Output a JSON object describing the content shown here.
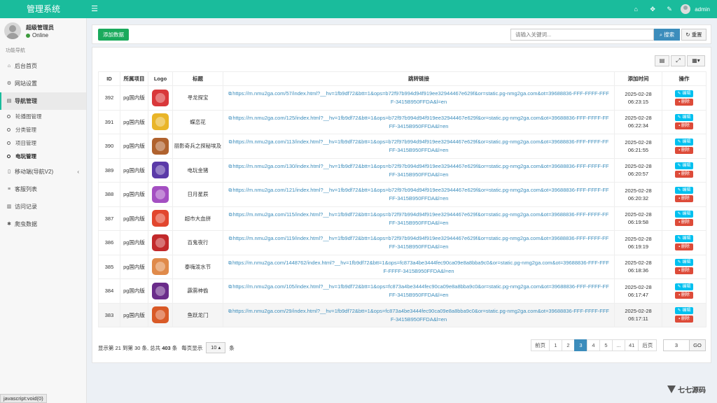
{
  "app": {
    "title": "管理系统"
  },
  "header": {
    "username": "admin"
  },
  "sidebar": {
    "user_name": "超级管理员",
    "status": "Online",
    "nav_header": "功能导航",
    "items": [
      {
        "label": "后台首页",
        "icon": "home-icon"
      },
      {
        "label": "网站设置",
        "icon": "cogs-icon"
      },
      {
        "label": "导航管理",
        "icon": "list-icon",
        "active": true
      },
      {
        "label": "移动端(导航V2)",
        "icon": "tablet-icon"
      },
      {
        "label": "客服列表",
        "icon": "bars-icon"
      },
      {
        "label": "访问记录",
        "icon": "chart-icon"
      },
      {
        "label": "爬虫数据",
        "icon": "bug-icon"
      }
    ],
    "subitems": [
      {
        "label": "轮播图管理"
      },
      {
        "label": "分类管理"
      },
      {
        "label": "项目管理"
      },
      {
        "label": "电玩管理",
        "active": true
      }
    ]
  },
  "toolbar": {
    "add_label": "添加数据",
    "search_placeholder": "请输入关键词...",
    "search_label": "搜索",
    "reset_label": "重置"
  },
  "table": {
    "columns": [
      "ID",
      "所属项目",
      "Logo",
      "标题",
      "跳转链接",
      "添加时间",
      "操作"
    ],
    "edit_label": "编辑",
    "delete_label": "删除",
    "rows": [
      {
        "id": "392",
        "project": "pg国内版",
        "logo_color": "#d9383a",
        "title": "寻龙探宝",
        "link": "https://m.nmu2ga.com/57/index.html?__hv=1fb9df72&btt=1&ops=b72f97b994d94f919ee32944467e629f&or=static.pg-nmg2ga.com&ot=39688836-FFF-FFFF-FFFF-3415B950FFDA&l=en",
        "date": "2025-02-28",
        "time": "06:23:15"
      },
      {
        "id": "391",
        "project": "pg国内版",
        "logo_color": "#e9b528",
        "title": "蝶恋花",
        "link": "https://m.nmu2ga.com/125/index.html?__hv=1fb9df72&btt=1&ops=b72f97b994d94f919ee32944467e629f&or=static.pg-nmg2ga.com&ot=39688836-FFF-FFFF-FFFF-3415B950FFDA&l=en",
        "date": "2025-02-28",
        "time": "06:22:34"
      },
      {
        "id": "390",
        "project": "pg国内版",
        "logo_color": "#b0622e",
        "title": "丽影奇兵之探秘埃及",
        "link": "https://m.nmu2ga.com/113/index.html?__hv=1fb9df72&btt=1&ops=b72f97b994d94f919ee32944467e629f&or=static.pg-nmg2ga.com&ot=39688836-FFF-FFFF-FFFF-3415B950FFDA&l=en",
        "date": "2025-02-28",
        "time": "06:21:55"
      },
      {
        "id": "389",
        "project": "pg国内版",
        "logo_color": "#5b3aa8",
        "title": "电玩金猪",
        "link": "https://m.nmu2ga.com/130/index.html?__hv=1fb9df72&btt=1&ops=b72f97b994d94f919ee32944467e629f&or=static.pg-nmg2ga.com&ot=39688836-FFF-FFFF-FFFF-3415B950FFDA&l=en",
        "date": "2025-02-28",
        "time": "06:20:57"
      },
      {
        "id": "388",
        "project": "pg国内版",
        "logo_color": "#a44fc2",
        "title": "日月星辰",
        "link": "https://m.nmu2ga.com/121/index.html?__hv=1fb9df72&btt=1&ops=b72f97b994d94f919ee32944467e629f&or=static.pg-nmg2ga.com&ot=39688836-FFF-FFFF-FFFF-3415B950FFDA&l=en",
        "date": "2025-02-28",
        "time": "06:20:32"
      },
      {
        "id": "387",
        "project": "pg国内版",
        "logo_color": "#e2462e",
        "title": "超市大血拼",
        "link": "https://m.nmu2ga.com/115/index.html?__hv=1fb9df72&btt=1&ops=b72f97b994d94f919ee32944467e629f&or=static.pg-nmg2ga.com&ot=39688836-FFF-FFFF-FFFF-3415B950FFDA&l=en",
        "date": "2025-02-28",
        "time": "06:19:58"
      },
      {
        "id": "386",
        "project": "pg国内版",
        "logo_color": "#c2292b",
        "title": "百鬼夜行",
        "link": "https://m.nmu2ga.com/119/index.html?__hv=1fb9df72&btt=1&ops=b72f97b994d94f919ee32944467e629f&or=static.pg-nmg2ga.com&ot=39688836-FFF-FFFF-FFFF-3415B950FFDA&l=en",
        "date": "2025-02-28",
        "time": "06:19:19"
      },
      {
        "id": "385",
        "project": "pg国内版",
        "logo_color": "#e08a4a",
        "title": "泰嗨泼水节",
        "link": "https://m.nmu2ga.com/1448762/index.html?__hv=1fb9df72&btt=1&ops=fc873a4be3444fec90ca09e8a8bba9c0&or=static.pg-nmg2ga.com&ot=39688836-FFF-FFFF-FFFF-3415B950FFDA&l=en",
        "date": "2025-02-28",
        "time": "06:18:36"
      },
      {
        "id": "384",
        "project": "pg国内版",
        "logo_color": "#6a2c8a",
        "title": "霹雳神偷",
        "link": "https://m.nmu2ga.com/105/index.html?__hv=1fb9df72&btt=1&ops=fc873a4be3444fec90ca09e8a8bba9c0&or=static.pg-nmg2ga.com&ot=39688836-FFF-FFFF-FFFF-3415B950FFDA&l=en",
        "date": "2025-02-28",
        "time": "06:17:47"
      },
      {
        "id": "383",
        "project": "pg国内版",
        "logo_color": "#d95a27",
        "title": "鱼跃龙门",
        "link": "https://m.nmu2ga.com/29/index.html?__hv=1fb9df72&btt=1&ops=fc873a4be3444fec90ca09e8a8bba9c0&or=static.pg-nmg2ga.com&ot=39688836-FFF-FFFF-FFFF-3415B950FFDA&l=en",
        "date": "2025-02-28",
        "time": "06:17:11",
        "highlight": true
      }
    ]
  },
  "pagination": {
    "info_prefix": "显示第 21 到第 30 条, 总共",
    "total": "403",
    "info_suffix": "条",
    "per_page_label": "每页显示",
    "per_page": "10",
    "per_page_suffix": "条",
    "prev": "前页",
    "pages": [
      "1",
      "2",
      "3",
      "4",
      "5",
      "...",
      "41"
    ],
    "active_page": "3",
    "next": "后页",
    "jump_value": "3",
    "go_label": "GO"
  },
  "statusbar": {
    "text": "javascript:void(0)"
  },
  "watermark": {
    "text": "七七源码"
  }
}
